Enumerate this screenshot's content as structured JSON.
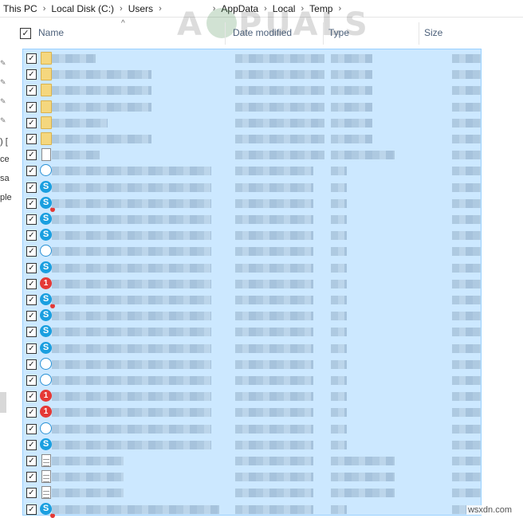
{
  "breadcrumb": [
    "This PC",
    "Local Disk (C:)",
    "Users",
    "AppData",
    "Local",
    "Temp"
  ],
  "watermark": {
    "text_left": "A",
    "text_right": "PUALS"
  },
  "navpane": {
    "fragments": [
      ") [",
      "ce",
      "sa",
      "ple"
    ]
  },
  "header": {
    "checkbox_glyph": "✓",
    "sort_glyph": "^",
    "columns": [
      "Name",
      "Date modified",
      "Type",
      "Size"
    ]
  },
  "check_glyph": "✓",
  "skype_glyph": "S",
  "alert_glyph": "1",
  "rows": [
    {
      "icon": "folder-icon"
    },
    {
      "icon": "folder-icon"
    },
    {
      "icon": "folder-icon"
    },
    {
      "icon": "folder-icon"
    },
    {
      "icon": "folder-icon"
    },
    {
      "icon": "folder-icon"
    },
    {
      "icon": "file-icon"
    },
    {
      "icon": "chat-bubble-icon"
    },
    {
      "icon": "skype-icon"
    },
    {
      "icon": "skype-notify-icon"
    },
    {
      "icon": "skype-icon"
    },
    {
      "icon": "skype-icon"
    },
    {
      "icon": "chat-bubble-icon"
    },
    {
      "icon": "skype-icon"
    },
    {
      "icon": "alert-icon"
    },
    {
      "icon": "skype-notify-icon"
    },
    {
      "icon": "skype-icon"
    },
    {
      "icon": "skype-icon"
    },
    {
      "icon": "skype-icon"
    },
    {
      "icon": "chat-bubble-icon"
    },
    {
      "icon": "chat-bubble-icon"
    },
    {
      "icon": "alert-icon"
    },
    {
      "icon": "alert-icon"
    },
    {
      "icon": "chat-bubble-icon"
    },
    {
      "icon": "skype-icon"
    },
    {
      "icon": "text-file-icon"
    },
    {
      "icon": "text-file-icon"
    },
    {
      "icon": "text-file-icon"
    },
    {
      "icon": "skype-notify-icon"
    }
  ],
  "credit": "wsxdn.com",
  "colors": {
    "selection": "#cce8ff",
    "selection_border": "#99d1ff",
    "skype": "#1a9fe0",
    "alert": "#e53935",
    "folder": "#f5d77e"
  }
}
